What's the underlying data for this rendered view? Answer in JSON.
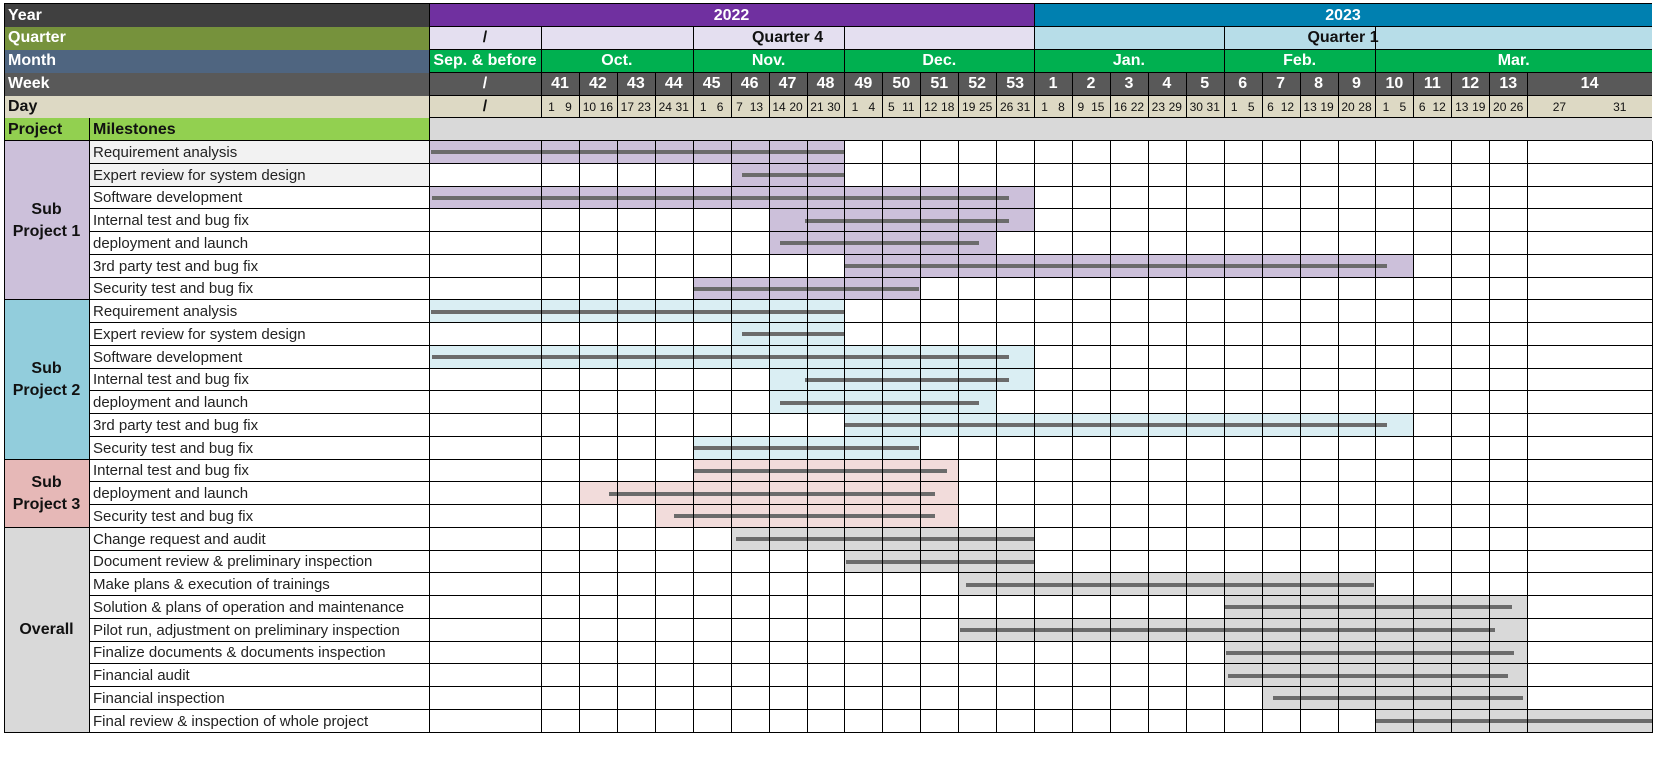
{
  "header": {
    "row_labels": {
      "year": "Year",
      "quarter": "Quarter",
      "month": "Month",
      "week": "Week",
      "day": "Day"
    },
    "table_headers": {
      "project": "Project",
      "milestones": "Milestones"
    },
    "pre_column": {
      "quarter": "/",
      "month": "Sep. & before",
      "week": "/",
      "day": "/"
    },
    "years": [
      {
        "label": "2022",
        "span": [
          0,
          14
        ],
        "color": "#7030a0"
      },
      {
        "label": "2023",
        "span": [
          14,
          28
        ],
        "color": "#0080b0"
      }
    ],
    "quarters": [
      {
        "label": "Quarter 4",
        "span": [
          1,
          14
        ],
        "color": "#e4dff0"
      },
      {
        "label": "Quarter 1",
        "span": [
          14,
          28
        ],
        "color": "#b7dde8"
      }
    ],
    "months": [
      {
        "label": "Oct.",
        "span": [
          1,
          5
        ]
      },
      {
        "label": "Nov.",
        "span": [
          5,
          9
        ]
      },
      {
        "label": "Dec.",
        "span": [
          9,
          14
        ]
      },
      {
        "label": "Jan.",
        "span": [
          14,
          19
        ]
      },
      {
        "label": "Feb.",
        "span": [
          19,
          23
        ]
      },
      {
        "label": "Mar.",
        "span": [
          23,
          28
        ]
      }
    ],
    "weeks": [
      "41",
      "42",
      "43",
      "44",
      "45",
      "46",
      "47",
      "48",
      "49",
      "50",
      "51",
      "52",
      "53",
      "1",
      "2",
      "3",
      "4",
      "5",
      "6",
      "7",
      "8",
      "9",
      "10",
      "11",
      "12",
      "13",
      "14"
    ],
    "days": [
      [
        "1",
        "9"
      ],
      [
        "10",
        "16"
      ],
      [
        "17",
        "23"
      ],
      [
        "24",
        "31"
      ],
      [
        "1",
        "6"
      ],
      [
        "7",
        "13"
      ],
      [
        "14",
        "20"
      ],
      [
        "21",
        "30"
      ],
      [
        "1",
        "4"
      ],
      [
        "5",
        "11"
      ],
      [
        "12",
        "18"
      ],
      [
        "19",
        "25"
      ],
      [
        "26",
        "31"
      ],
      [
        "1",
        "8"
      ],
      [
        "9",
        "15"
      ],
      [
        "16",
        "22"
      ],
      [
        "23",
        "29"
      ],
      [
        "30",
        "31"
      ],
      [
        "1",
        "5"
      ],
      [
        "6",
        "12"
      ],
      [
        "13",
        "19"
      ],
      [
        "20",
        "28"
      ],
      [
        "1",
        "5"
      ],
      [
        "6",
        "12"
      ],
      [
        "13",
        "19"
      ],
      [
        "20",
        "26"
      ],
      [
        "27",
        "31"
      ]
    ]
  },
  "colors": {
    "year_label_bg": "#404040",
    "quarter_label_bg": "#76923c",
    "month_label_bg": "#4f6580",
    "week_bg": "#595959",
    "day_bg": "#ddd9c4",
    "month_bg": "#00b050",
    "project_header_bg": "#92d050",
    "bar_line": "#6b6b6b"
  },
  "chart_data": {
    "type": "gantt",
    "title": "",
    "timeline_units": "column index: 0 = 'Sep. & before', 1..27 = weeks 41..53 (2022) and 1..14 (2023)",
    "groups": [
      {
        "name": "Sub Project 1",
        "label_lines": [
          "Sub",
          "Project 1"
        ],
        "color": "#ccc0da",
        "tasks": [
          {
            "name": "Requirement analysis",
            "shade": [
              0,
              9
            ],
            "line": [
              0.02,
              9.0
            ],
            "label_bg": "#f2f2f2"
          },
          {
            "name": "Expert review for system design",
            "shade": [
              6,
              9
            ],
            "line": [
              6.3,
              9.0
            ],
            "label_bg": "#f2f2f2"
          },
          {
            "name": "Software development",
            "shade": [
              0,
              14
            ],
            "line": [
              0.03,
              13.35
            ]
          },
          {
            "name": "Internal test and bug fix",
            "shade": [
              7,
              14
            ],
            "line": [
              7.95,
              13.35
            ]
          },
          {
            "name": "deployment and launch",
            "shade": [
              7,
              13
            ],
            "line": [
              7.3,
              12.55
            ]
          },
          {
            "name": "3rd party test and bug fix",
            "shade": [
              9,
              24
            ],
            "line": [
              9.0,
              23.3
            ]
          },
          {
            "name": "Security test and bug fix",
            "shade": [
              5,
              11
            ],
            "line": [
              5.0,
              10.97
            ]
          }
        ]
      },
      {
        "name": "Sub Project 2",
        "label_lines": [
          "Sub",
          "Project 2"
        ],
        "color": "#92cddc",
        "shade_color": "#daeef3",
        "tasks": [
          {
            "name": "Requirement analysis",
            "shade": [
              0,
              9
            ],
            "line": [
              0.02,
              9.0
            ]
          },
          {
            "name": "Expert review for system design",
            "shade": [
              6,
              9
            ],
            "line": [
              6.3,
              9.0
            ]
          },
          {
            "name": "Software development",
            "shade": [
              0,
              14
            ],
            "line": [
              0.03,
              13.35
            ]
          },
          {
            "name": "Internal test and bug fix",
            "shade": [
              7,
              14
            ],
            "line": [
              7.95,
              13.35
            ]
          },
          {
            "name": "deployment and launch",
            "shade": [
              7,
              13
            ],
            "line": [
              7.3,
              12.55
            ]
          },
          {
            "name": "3rd party test and bug fix",
            "shade": [
              9,
              24
            ],
            "line": [
              9.0,
              23.3
            ]
          },
          {
            "name": "Security test and bug fix",
            "shade": [
              5,
              11
            ],
            "line": [
              5.03,
              10.97
            ]
          }
        ]
      },
      {
        "name": "Sub Project 3",
        "label_lines": [
          "Sub",
          "Project 3"
        ],
        "color": "#e6b8b7",
        "shade_color": "#f2dcdb",
        "tasks": [
          {
            "name": "Internal test and bug fix",
            "shade": [
              5,
              12
            ],
            "line": [
              5.0,
              11.7
            ]
          },
          {
            "name": "deployment and launch",
            "shade": [
              2,
              12
            ],
            "line": [
              2.8,
              11.4
            ]
          },
          {
            "name": "Security test and bug fix",
            "shade": [
              4,
              12
            ],
            "line": [
              4.5,
              11.4
            ]
          }
        ]
      },
      {
        "name": "Overall",
        "label_lines": [
          "Overall"
        ],
        "color": "#d9d9d9",
        "shade_color": "#d9d9d9",
        "tasks": [
          {
            "name": "Change request and audit",
            "shade": [
              6,
              14
            ],
            "line": [
              6.15,
              14.0
            ]
          },
          {
            "name": "Document review & preliminary inspection",
            "shade": [
              9,
              14
            ],
            "line": [
              9.05,
              14.0
            ]
          },
          {
            "name": "Make plans & execution of trainings",
            "shade": [
              12,
              23
            ],
            "line": [
              12.2,
              22.95
            ]
          },
          {
            "name": "Solution & plans of operation and maintenance",
            "shade": [
              19,
              27
            ],
            "line": [
              19.0,
              26.6
            ]
          },
          {
            "name": "Pilot run, adjustment on preliminary inspection",
            "shade": [
              12,
              27
            ],
            "line": [
              12.05,
              26.15
            ]
          },
          {
            "name": "Finalize documents & documents inspection",
            "shade": [
              19,
              27
            ],
            "line": [
              19.05,
              26.65
            ]
          },
          {
            "name": "Financial audit",
            "shade": [
              19,
              27
            ],
            "line": [
              19.1,
              26.5
            ]
          },
          {
            "name": "Financial inspection",
            "shade": [
              20,
              27
            ],
            "line": [
              20.3,
              26.9
            ]
          },
          {
            "name": "Final review & inspection of whole project",
            "shade": [
              23,
              28
            ],
            "line": [
              23.0,
              28.0
            ]
          }
        ]
      }
    ]
  }
}
